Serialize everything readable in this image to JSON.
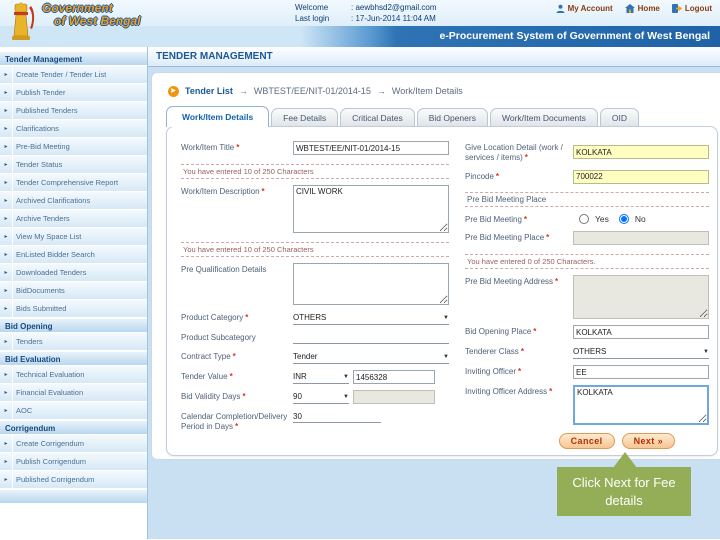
{
  "icons": {
    "bullet": "▸",
    "breadcrumb_bullet": "▶",
    "select_arrow": "▼"
  },
  "header": {
    "logo_line1": "Government",
    "logo_line2": "of West Bengal",
    "welcome_label": "Welcome",
    "welcome_value": ": aewbhsd2@gmail.com",
    "last_login_label": "Last login",
    "last_login_value": ": 17-Jun-2014 11:04 AM",
    "app_title": "e-Procurement System of Government of West Bengal",
    "links": {
      "my_account": "My Account",
      "home": "Home",
      "logout": "Logout"
    }
  },
  "sidebar": {
    "sections": [
      {
        "title": "Tender Management",
        "items": [
          "Create Tender / Tender List",
          "Publish Tender",
          "Published Tenders",
          "Clarifications",
          "Pre-Bid Meeting",
          "Tender Status",
          "Tender Comprehensive Report",
          "Archived Clarifications",
          "Archive Tenders",
          "View My Space List",
          "EnListed Bidder Search",
          "Downloaded Tenders",
          "BidDocuments",
          "Bids Submitted"
        ]
      },
      {
        "title": "Bid Opening",
        "items": [
          "Tenders"
        ]
      },
      {
        "title": "Bid Evaluation",
        "items": [
          "Technical Evaluation",
          "Financial Evaluation",
          "AOC"
        ]
      },
      {
        "title": "Corrigendum",
        "items": [
          "Create Corrigendum",
          "Publish Corrigendum",
          "Published Corrigendum"
        ]
      }
    ]
  },
  "main": {
    "page_title": "TENDER MANAGEMENT",
    "breadcrumb": {
      "root": "Tender List",
      "sep": "→",
      "tender_id": "WBTEST/EE/NIT-01/2014-15",
      "current": "Work/Item Details"
    },
    "tabs": [
      "Work/Item Details",
      "Fee Details",
      "Critical Dates",
      "Bid Openers",
      "Work/Item Documents",
      "OID"
    ]
  },
  "form": {
    "left": {
      "work_item_title": {
        "label": "Work/Item Title",
        "req": "*",
        "value": "WBTEST/EE/NIT-01/2014-15"
      },
      "title_counter": "You have entered 10 of 250 Characters",
      "work_item_description": {
        "label": "Work/Item Description",
        "req": "*",
        "value": "CIVIL WORK"
      },
      "description_counter": "You have entered 10 of 250 Characters",
      "pre_qualification": {
        "label": "Pre Qualification Details",
        "value": ""
      },
      "product_category": {
        "label": "Product Category",
        "req": "*",
        "value": "OTHERS"
      },
      "product_subcategory": {
        "label": "Product Subcategory",
        "value": ""
      },
      "contract_type": {
        "label": "Contract Type",
        "req": "*",
        "value": "Tender"
      },
      "tender_value": {
        "label": "Tender Value",
        "req": "*",
        "currency": "INR",
        "value": "1456328"
      },
      "bid_validity_days": {
        "label": "Bid Validity Days",
        "req": "*",
        "value": "90"
      },
      "calendar_period": {
        "label": "Calendar Completion/Delivery Period in Days",
        "req": "*",
        "value": "30"
      }
    },
    "right": {
      "location": {
        "label": "Give Location Detail (work / services / items)",
        "req": "*",
        "value": "KOLKATA"
      },
      "pincode": {
        "label": "Pincode",
        "req": "*",
        "value": "700022"
      },
      "prebid_section_title": "Pre Bid Meeting Place",
      "prebid_meeting": {
        "label": "Pre Bid Meeting",
        "req": "*",
        "option_yes": "Yes",
        "option_no": "No",
        "selected": "No"
      },
      "prebid_place": {
        "label": "Pre Bid Meeting Place",
        "req": "*",
        "value": ""
      },
      "prebid_counter": "You have entered 0 of 250 Characters.",
      "prebid_address": {
        "label": "Pre Bid Meeting Address",
        "req": "*",
        "value": ""
      },
      "bid_opening_place": {
        "label": "Bid Opening Place",
        "req": "*",
        "value": "KOLKATA"
      },
      "tenderer_class": {
        "label": "Tenderer Class",
        "req": "*",
        "value": "OTHERS"
      },
      "inviting_officer": {
        "label": "Inviting Officer",
        "req": "*",
        "value": "EE"
      },
      "inviting_officer_address": {
        "label": "Inviting Officer Address",
        "req": "*",
        "value": "KOLKATA"
      }
    },
    "actions": {
      "cancel": "Cancel",
      "next": "Next »"
    }
  },
  "tooltip": {
    "text": "Click Next for Fee details"
  }
}
